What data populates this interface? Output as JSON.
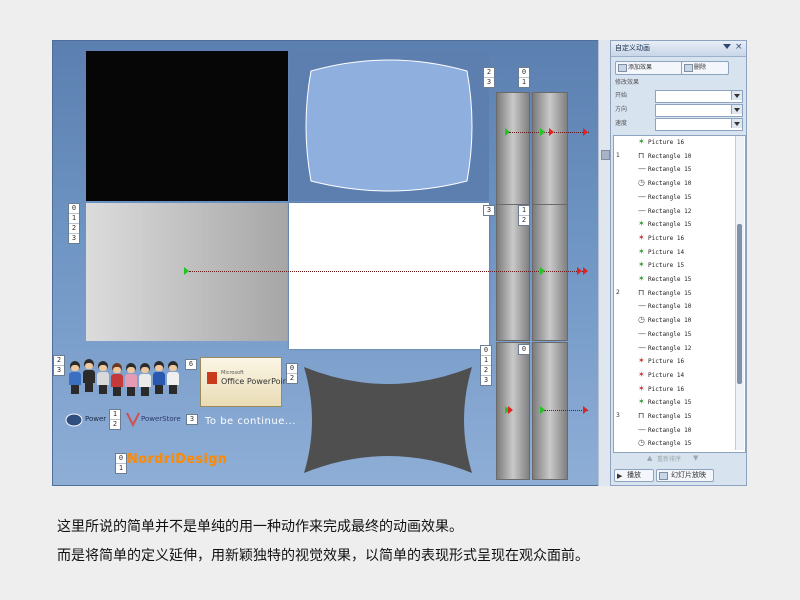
{
  "canvas": {
    "left_numbers_1": [
      "0",
      "1",
      "2",
      "3"
    ],
    "top_right_numbers": [
      "2",
      "3"
    ],
    "col1_numbers_top": [
      "0",
      "1"
    ],
    "mid_number_left": "3",
    "col1_numbers_mid": [
      "1",
      "2"
    ],
    "col2_numbers_mid": [
      "1",
      "2"
    ],
    "row3_numbers_left": [
      "2",
      "3"
    ],
    "row3_number_6": "6",
    "row3_numbers_right": [
      "0",
      "2"
    ],
    "lower_numbers_col": [
      "0",
      "1",
      "2",
      "3"
    ],
    "lower_number_0": "0",
    "power_number": [
      "1",
      "2"
    ],
    "powerstore_number": "3",
    "nordri_number": [
      "0",
      "1"
    ],
    "ppt_logo_small": "Microsoft",
    "ppt_logo_text": "Office PowerPoint",
    "power_label": "Power",
    "powerstore_label": "PowerStore",
    "continue_text": "To be continue...",
    "nordri_logo": "NordriDesign"
  },
  "task_pane": {
    "title": "自定义动画",
    "add_effect_label": "添加效果",
    "delete_label": "删除",
    "modify_label": "修改效果",
    "start_label": "开始",
    "direction_label": "方向",
    "speed_label": "速度",
    "start_value": "",
    "direction_value": "",
    "speed_value": "",
    "items": [
      {
        "step": "",
        "icon": "star-green",
        "label": "Picture 16"
      },
      {
        "step": "1",
        "icon": "mouse",
        "label": "Rectangle 10"
      },
      {
        "step": "",
        "icon": "line",
        "label": "Rectangle 15"
      },
      {
        "step": "",
        "icon": "clock",
        "label": "Rectangle 10"
      },
      {
        "step": "",
        "icon": "line",
        "label": "Rectangle 15"
      },
      {
        "step": "",
        "icon": "line",
        "label": "Rectangle 12"
      },
      {
        "step": "",
        "icon": "star-green",
        "label": "Rectangle 15"
      },
      {
        "step": "",
        "icon": "star-red",
        "label": "Picture 16"
      },
      {
        "step": "",
        "icon": "star-green",
        "label": "Picture 14"
      },
      {
        "step": "",
        "icon": "star-green",
        "label": "Picture 15"
      },
      {
        "step": "",
        "icon": "star-green",
        "label": "Rectangle 15"
      },
      {
        "step": "2",
        "icon": "mouse",
        "label": "Rectangle 15"
      },
      {
        "step": "",
        "icon": "line",
        "label": "Rectangle 10"
      },
      {
        "step": "",
        "icon": "clock",
        "label": "Rectangle 10"
      },
      {
        "step": "",
        "icon": "line",
        "label": "Rectangle 15"
      },
      {
        "step": "",
        "icon": "line",
        "label": "Rectangle 12"
      },
      {
        "step": "",
        "icon": "star-red",
        "label": "Picture 16"
      },
      {
        "step": "",
        "icon": "star-red",
        "label": "Picture 14"
      },
      {
        "step": "",
        "icon": "star-red",
        "label": "Picture 16"
      },
      {
        "step": "",
        "icon": "star-green",
        "label": "Rectangle 15"
      },
      {
        "step": "3",
        "icon": "mouse",
        "label": "Rectangle 15"
      },
      {
        "step": "",
        "icon": "line",
        "label": "Rectangle 10"
      },
      {
        "step": "",
        "icon": "clock",
        "label": "Rectangle 15"
      }
    ],
    "reorder_label": "重新排序",
    "play_label": "播放",
    "slideshow_label": "幻灯片放映"
  },
  "captions": {
    "line1": "这里所说的简单并不是单纯的用一种动作来完成最终的动画效果。",
    "line2": "而是将简单的定义延伸，用新颖独特的视觉效果，以简单的表现形式呈现在观众面前。"
  },
  "colors": {
    "slide_bg": "#6f95c4",
    "task_pane_bg": "#d8e3f0",
    "start_marker": "#22c422",
    "end_marker": "#e02222"
  }
}
